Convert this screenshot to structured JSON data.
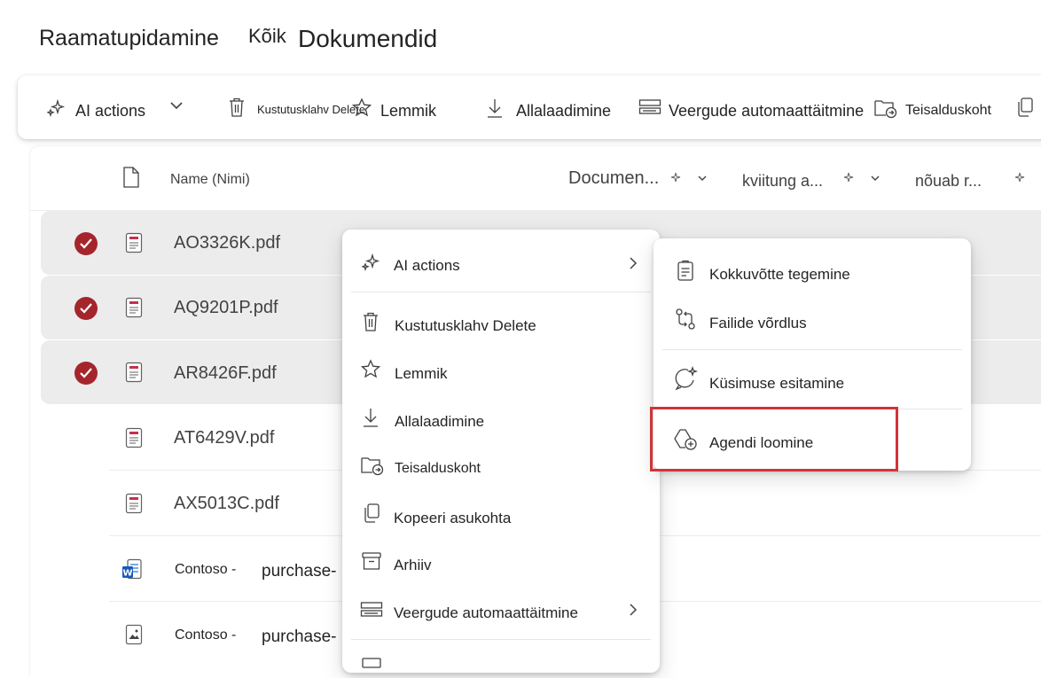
{
  "breadcrumb": {
    "part1": "Raamatupidamine",
    "part2": "Kõik",
    "part3": "Dokumendid"
  },
  "toolbar": {
    "ai_actions": "AI actions",
    "delete": "Kustutusklahv Delete",
    "favorite": "Lemmik",
    "download": "Allalaadimine",
    "autofill": "Veergude automaattäitmine",
    "move_to": "Teisalduskoht"
  },
  "columns": {
    "name": "Name (Nimi)",
    "document": "Documen...",
    "receipt": "kviitung a...",
    "requires": "nõuab r..."
  },
  "files": [
    {
      "name": "AO3326K.pdf",
      "selected": true,
      "type": "pdf"
    },
    {
      "name": "AQ9201P.pdf",
      "selected": true,
      "type": "pdf"
    },
    {
      "name": "AR8426F.pdf",
      "selected": true,
      "type": "pdf"
    },
    {
      "name": "AT6429V.pdf",
      "selected": false,
      "type": "pdf"
    },
    {
      "name": "AX5013C.pdf",
      "selected": false,
      "type": "pdf"
    },
    {
      "name_a": "Contoso -",
      "name_b": "purchase-",
      "selected": false,
      "type": "word"
    },
    {
      "name_a": "Contoso -",
      "name_b": "purchase-",
      "selected": false,
      "type": "image"
    }
  ],
  "context_menu": {
    "ai_actions": "AI actions",
    "delete": "Kustutusklahv Delete",
    "favorite": "Lemmik",
    "download": "Allalaadimine",
    "move_to": "Teisalduskoht",
    "copy_path": "Kopeeri asukohta",
    "archive": "Arhiiv",
    "autofill": "Veergude automaattäitmine"
  },
  "submenu": {
    "summarize": "Kokkuvõtte tegemine",
    "compare": "Failide võrdlus",
    "ask": "Küsimuse esitamine",
    "create_agent": "Agendi loomine"
  },
  "colors": {
    "check": "#a4262c",
    "highlight": "#d13438",
    "selected_row": "#ececec"
  }
}
